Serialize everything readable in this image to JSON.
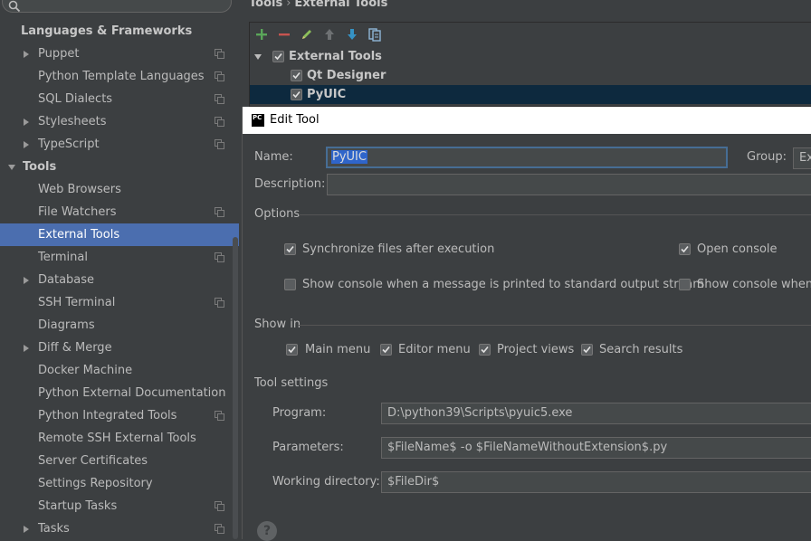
{
  "sidebar": {
    "items": [
      {
        "label": "Languages & Frameworks",
        "bold": true
      },
      {
        "label": "Puppet",
        "arrow": "right",
        "proj": true
      },
      {
        "label": "Python Template Languages",
        "proj": true
      },
      {
        "label": "SQL Dialects",
        "proj": true
      },
      {
        "label": "Stylesheets",
        "arrow": "right",
        "proj": true
      },
      {
        "label": "TypeScript",
        "arrow": "right",
        "proj": true
      },
      {
        "label": "Tools",
        "arrow": "down",
        "bold": true
      },
      {
        "label": "Web Browsers"
      },
      {
        "label": "File Watchers",
        "proj": true
      },
      {
        "label": "External Tools",
        "selected": true
      },
      {
        "label": "Terminal",
        "proj": true
      },
      {
        "label": "Database",
        "arrow": "right"
      },
      {
        "label": "SSH Terminal",
        "proj": true
      },
      {
        "label": "Diagrams"
      },
      {
        "label": "Diff & Merge",
        "arrow": "right"
      },
      {
        "label": "Docker Machine"
      },
      {
        "label": "Python External Documentation"
      },
      {
        "label": "Python Integrated Tools",
        "proj": true
      },
      {
        "label": "Remote SSH External Tools"
      },
      {
        "label": "Server Certificates"
      },
      {
        "label": "Settings Repository"
      },
      {
        "label": "Startup Tasks",
        "proj": true
      },
      {
        "label": "Tasks",
        "arrow": "right",
        "proj": true
      }
    ]
  },
  "breadcrumb": {
    "root": "Tools",
    "separator": "›",
    "current": "External Tools"
  },
  "tree": {
    "group": "External Tools",
    "items": [
      "Qt Designer",
      "PyUIC"
    ]
  },
  "dialog": {
    "title": "Edit Tool",
    "name_label": "Name:",
    "name_value": "PyUIC",
    "group_label": "Group:",
    "group_value": "Ext",
    "description_label": "Description:",
    "description_value": "",
    "options_header": "Options",
    "opt_sync": "Synchronize files after execution",
    "opt_open_console": "Open console",
    "opt_show_console_stdout": "Show console when a message is printed to standard output stream",
    "opt_show_console_stderr": "Show console when a",
    "show_in_header": "Show in",
    "show_main_menu": "Main menu",
    "show_editor_menu": "Editor menu",
    "show_project_views": "Project views",
    "show_search_results": "Search results",
    "tool_settings_header": "Tool settings",
    "program_label": "Program:",
    "program_value": "D:\\python39\\Scripts\\pyuic5.exe",
    "parameters_label": "Parameters:",
    "parameters_value": "$FileName$ -o $FileNameWithoutExtension$.py",
    "workdir_label": "Working directory:",
    "workdir_value": "$FileDir$",
    "help": "?"
  },
  "colors": {
    "selection": "#4b6eaf",
    "tree_selection": "#0d293e",
    "add": "#5aa65a",
    "remove": "#c75450",
    "accent_blue": "#3592c4"
  }
}
